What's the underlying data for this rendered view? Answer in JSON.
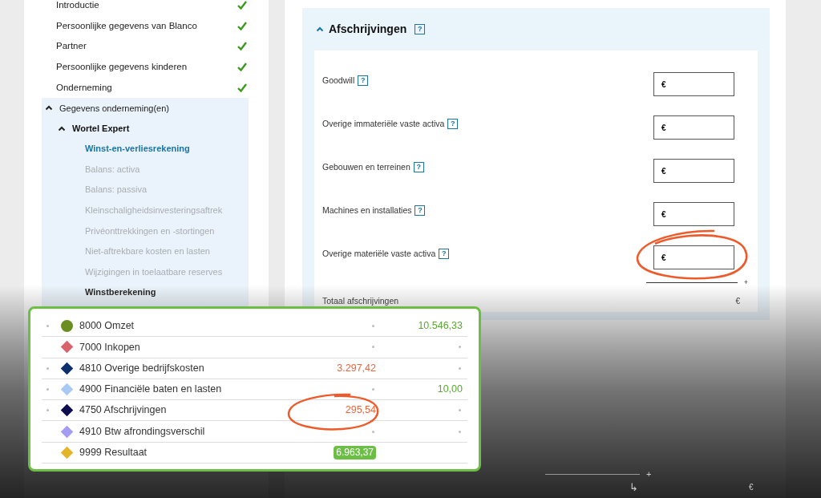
{
  "sidebar": {
    "items": [
      {
        "label": "Introductie",
        "completed": true
      },
      {
        "label": "Persoonlijke gegevens van Blanco",
        "completed": true
      },
      {
        "label": "Partner",
        "completed": true
      },
      {
        "label": "Persoonlijke gegevens kinderen",
        "completed": true
      },
      {
        "label": "Onderneming",
        "completed": true
      },
      {
        "label": "Gegevens onderneming(en)",
        "expanded": true,
        "children": [
          {
            "label": "Wortel Expert",
            "expanded": true,
            "children": [
              {
                "label": "Winst-en-verliesrekening",
                "selected": true,
                "disabled": false
              },
              {
                "label": "Balans: activa",
                "selected": false,
                "disabled": true
              },
              {
                "label": "Balans: passiva",
                "selected": false,
                "disabled": true
              },
              {
                "label": "Kleinschaligheidsinvesteringsaftrek",
                "selected": false,
                "disabled": true
              },
              {
                "label": "Privéonttrekkingen en -stortingen",
                "selected": false,
                "disabled": true
              },
              {
                "label": "Niet-aftrekbare kosten en lasten",
                "selected": false,
                "disabled": true
              },
              {
                "label": "Wijzigingen in toelaatbare reserves",
                "selected": false,
                "disabled": true
              },
              {
                "label": "Winstberekening",
                "selected": false,
                "disabled": false
              }
            ]
          }
        ]
      }
    ]
  },
  "section": {
    "title": "Afschrijvingen",
    "help": "?",
    "expanded": true,
    "fields": [
      {
        "label": "Goodwill",
        "help": "?",
        "currency": "€",
        "highlighted": false
      },
      {
        "label": "Overige immateriële vaste activa",
        "help": "?",
        "currency": "€",
        "highlighted": false
      },
      {
        "label": "Gebouwen en terreinen",
        "help": "?",
        "currency": "€",
        "highlighted": false
      },
      {
        "label": "Machines en installaties",
        "help": "?",
        "currency": "€",
        "highlighted": false
      },
      {
        "label": "Overige materiële vaste activa",
        "help": "?",
        "currency": "€",
        "highlighted": true
      }
    ],
    "sum_sign": "+",
    "total_label": "Totaal afschrijvingen",
    "total_currency": "€"
  },
  "lower_form": {
    "sum_sign": "+",
    "arrow": "↳",
    "currency": "€"
  },
  "overlay": {
    "rows": [
      {
        "bullet": true,
        "kind": "circle",
        "color": "#6b8e23",
        "label": "8000 Omzet",
        "credit": "10.546,33",
        "highlighted": false
      },
      {
        "bullet": false,
        "kind": "diamond",
        "color": "#d9626b",
        "label": "7000 Inkopen",
        "highlighted": false
      },
      {
        "bullet": true,
        "kind": "diamond",
        "color": "#0d2f6b",
        "label": "4810 Overige bedrijfskosten",
        "debit": "3.297,42",
        "highlighted": false
      },
      {
        "bullet": true,
        "kind": "diamond",
        "color": "#a9c9f5",
        "label": "4900 Financiële baten en lasten",
        "credit": "10,00",
        "highlighted": false
      },
      {
        "bullet": true,
        "kind": "diamond",
        "color": "#0e0e4f",
        "label": "4750 Afschrijvingen",
        "debit": "295,54",
        "highlighted": true
      },
      {
        "bullet": false,
        "kind": "diamond",
        "color": "#a39cf3",
        "label": "4910 Btw afrondingsverschil",
        "highlighted": false
      },
      {
        "bullet": false,
        "kind": "diamond",
        "color": "#e3b52b",
        "label": "9999 Resultaat",
        "result": "6.963,37",
        "highlighted": false
      }
    ]
  }
}
